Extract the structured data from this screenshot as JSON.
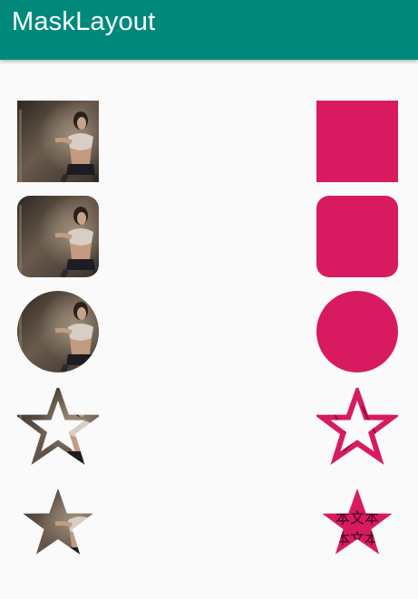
{
  "app_bar": {
    "title": "MaskLayout"
  },
  "colors": {
    "primary": "#00897b",
    "accent": "#d81b60",
    "background": "#fafafa"
  },
  "rows": [
    {
      "shape": "square",
      "left": "photo",
      "right": "accent-fill"
    },
    {
      "shape": "rounded-square",
      "left": "photo",
      "right": "accent-fill"
    },
    {
      "shape": "circle",
      "left": "photo",
      "right": "accent-fill"
    },
    {
      "shape": "star-outline",
      "left": "photo",
      "right": "accent-fill"
    },
    {
      "shape": "star-filled",
      "left": "photo",
      "right": "accent-text-fill"
    }
  ],
  "star_text": {
    "line1": "本文本",
    "line2": "本文本"
  }
}
